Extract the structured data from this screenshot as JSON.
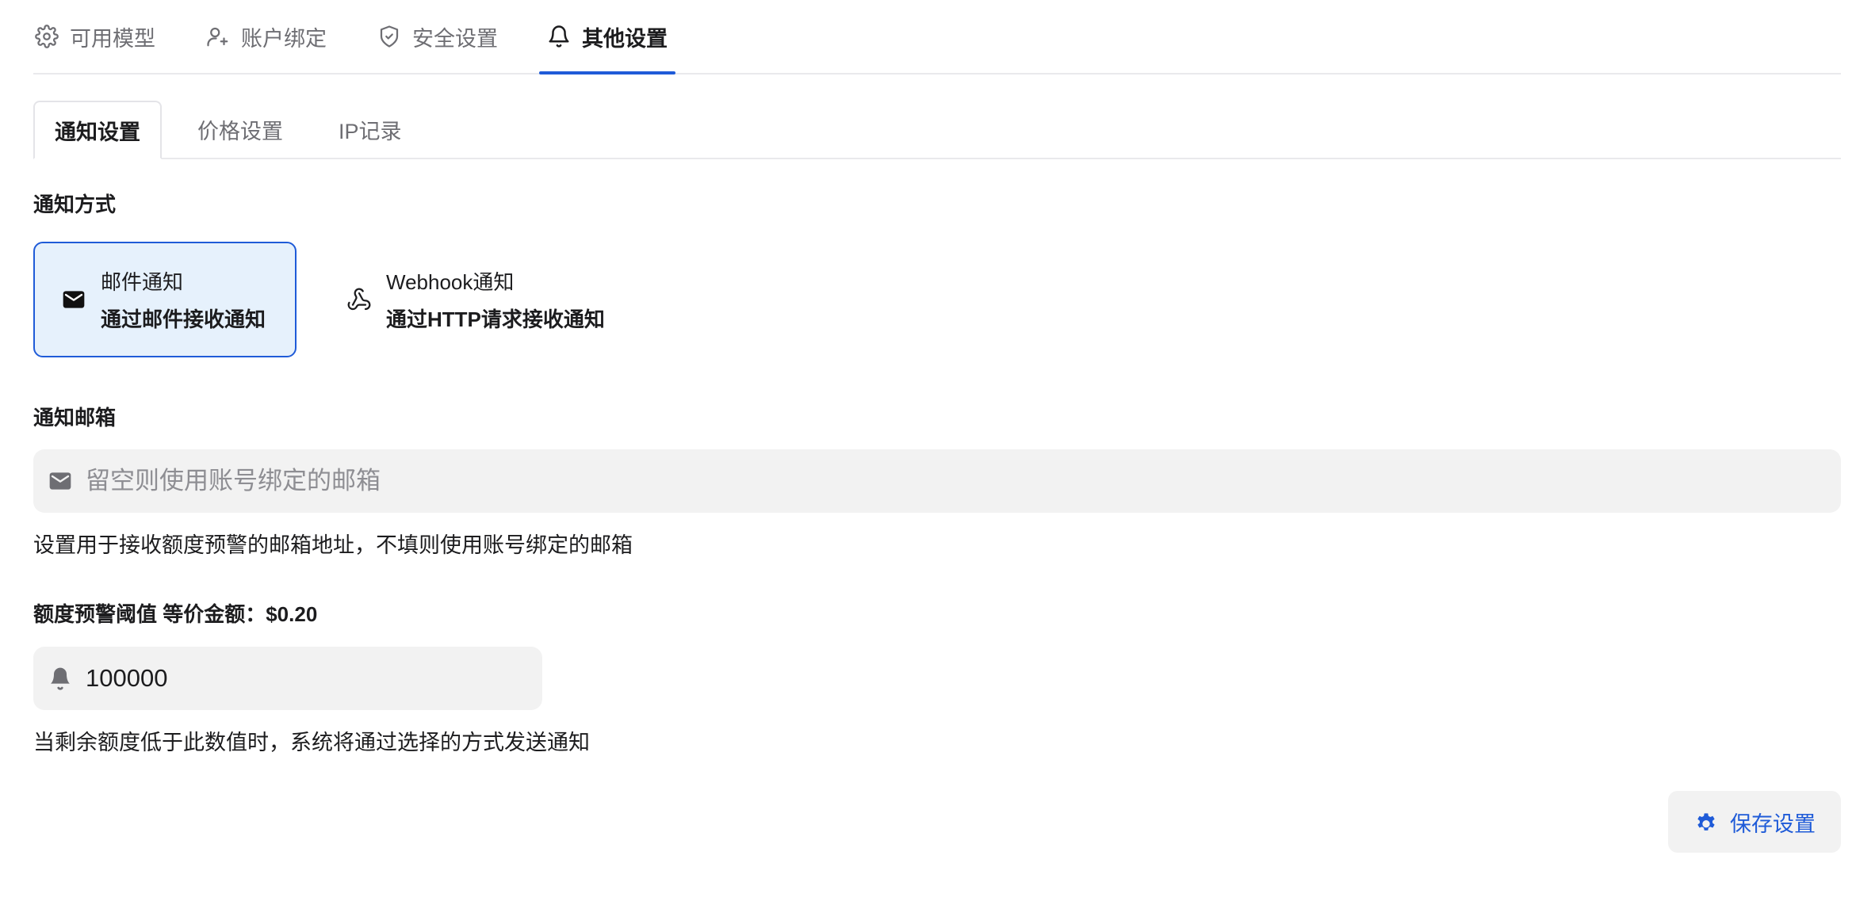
{
  "top_tabs": [
    {
      "label": "可用模型",
      "icon": "gear-icon",
      "active": false
    },
    {
      "label": "账户绑定",
      "icon": "user-plus-icon",
      "active": false
    },
    {
      "label": "安全设置",
      "icon": "shield-check-icon",
      "active": false
    },
    {
      "label": "其他设置",
      "icon": "bell-icon",
      "active": true
    }
  ],
  "sub_tabs": [
    {
      "label": "通知设置",
      "active": true
    },
    {
      "label": "价格设置",
      "active": false
    },
    {
      "label": "IP记录",
      "active": false
    }
  ],
  "notify_method": {
    "label": "通知方式",
    "options": [
      {
        "title": "邮件通知",
        "description": "通过邮件接收通知",
        "icon": "mail-icon",
        "selected": true
      },
      {
        "title": "Webhook通知",
        "description": "通过HTTP请求接收通知",
        "icon": "webhook-icon",
        "selected": false
      }
    ]
  },
  "notify_email": {
    "label": "通知邮箱",
    "value": "",
    "placeholder": "留空则使用账号绑定的邮箱",
    "icon": "mail-icon",
    "help": "设置用于接收额度预警的邮箱地址，不填则使用账号绑定的邮箱"
  },
  "quota_threshold": {
    "label": "额度预警阈值 等价金额：$0.20",
    "value": "100000",
    "icon": "bell-icon",
    "help": "当剩余额度低于此数值时，系统将通过选择的方式发送通知"
  },
  "save_button": {
    "label": "保存设置",
    "icon": "gear-filled-icon"
  },
  "colors": {
    "accent": "#1f5bd8",
    "selected_bg": "#e6f1fc",
    "input_bg": "#f2f2f2",
    "muted": "#6e6e73"
  }
}
